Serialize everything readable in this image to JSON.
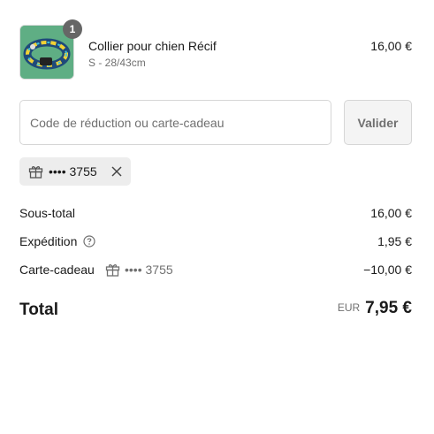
{
  "product": {
    "quantity": "1",
    "title": "Collier pour chien Récif",
    "variant": "S - 28/43cm",
    "price": "16,00 €",
    "image_icon": "dog-collar-image"
  },
  "discount": {
    "placeholder": "Code de réduction ou carte-cadeau",
    "value": "",
    "apply_label": "Valider"
  },
  "applied_gift_card": {
    "icon": "gift-icon",
    "label": "•••• 3755",
    "remove_icon": "close-icon"
  },
  "summary": {
    "subtotal_label": "Sous-total",
    "subtotal_value": "16,00 €",
    "shipping_label": "Expédition",
    "shipping_help_icon": "question-circle-icon",
    "shipping_value": "1,95 €",
    "giftcard_label": "Carte-cadeau",
    "giftcard_code": "•••• 3755",
    "giftcard_value": "−10,00 €",
    "total_label": "Total",
    "currency": "EUR",
    "total_value": "7,95 €"
  },
  "colors": {
    "thumb_background": "#5fae84",
    "badge": "#666666",
    "muted_text": "#707070",
    "chip_background": "#ededed"
  }
}
